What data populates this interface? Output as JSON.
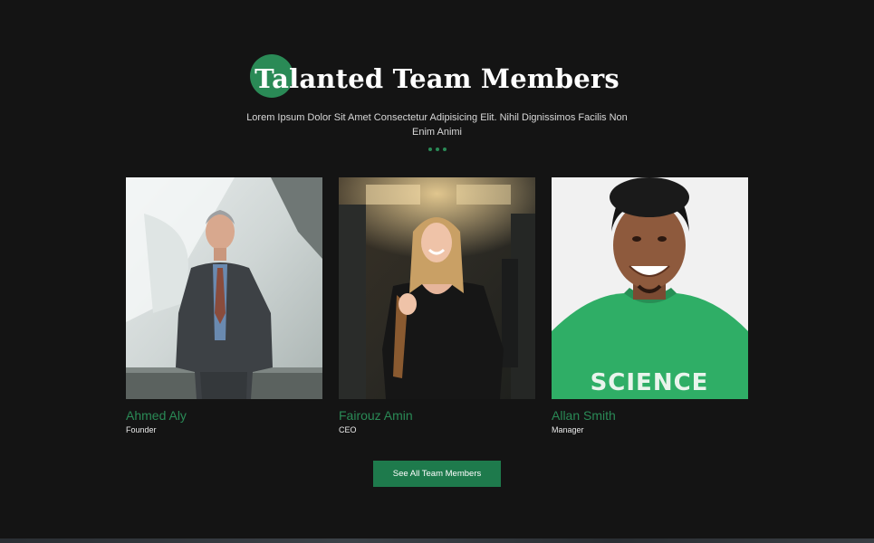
{
  "section": {
    "title": "Talanted Team Members",
    "subtitle": "Lorem Ipsum Dolor Sit Amet Consectetur Adipisicing Elit. Nihil Dignissimos Facilis Non Enim Animi",
    "accent_color": "#2a8a56"
  },
  "team": [
    {
      "name": "Ahmed Aly",
      "role": "Founder",
      "photo": "man-in-suit-photo"
    },
    {
      "name": "Fairouz Amin",
      "role": "CEO",
      "photo": "woman-in-black-shirt-photo"
    },
    {
      "name": "Allan Smith",
      "role": "Manager",
      "photo": "man-in-green-shirt-photo"
    }
  ],
  "cta": {
    "label": "See All Team Members"
  },
  "colors": {
    "background": "#141414",
    "button": "#1e7a4c"
  }
}
